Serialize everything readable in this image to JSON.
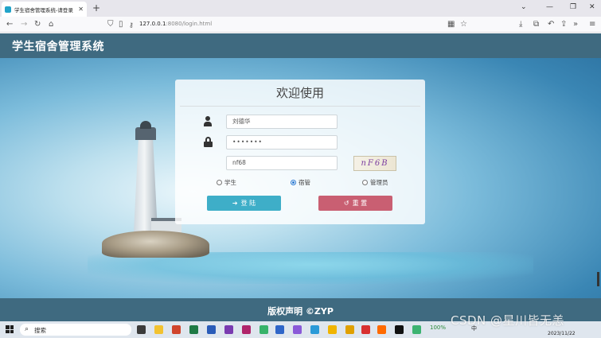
{
  "browser": {
    "tab_title": "学生宿舍管理系统-请登录",
    "url_host": "127.0.0.1",
    "url_rest": ":8080/login.html"
  },
  "header": {
    "title": "学生宿舍管理系统"
  },
  "login": {
    "title": "欢迎使用",
    "username": "刘德华",
    "password": "•••••••",
    "captcha_input": "nf68",
    "captcha_image_text": "nF6B",
    "roles": [
      {
        "label": "学生",
        "selected": false
      },
      {
        "label": "宿管",
        "selected": true
      },
      {
        "label": "管理员",
        "selected": false
      }
    ],
    "login_label": "登 陆",
    "reset_label": "重 置"
  },
  "footer": {
    "text": "版权声明 ©ZYP"
  },
  "taskbar": {
    "search_label": "搜索",
    "battery": "100%",
    "ime": "中",
    "date": "2023/11/22"
  },
  "watermark": "CSDN @星川皆无恙",
  "colors": {
    "header_bg": "#3f6a80",
    "login_button": "#3eaec8",
    "reset_button": "#c95f72",
    "radio_accent": "#2b7bd3"
  }
}
